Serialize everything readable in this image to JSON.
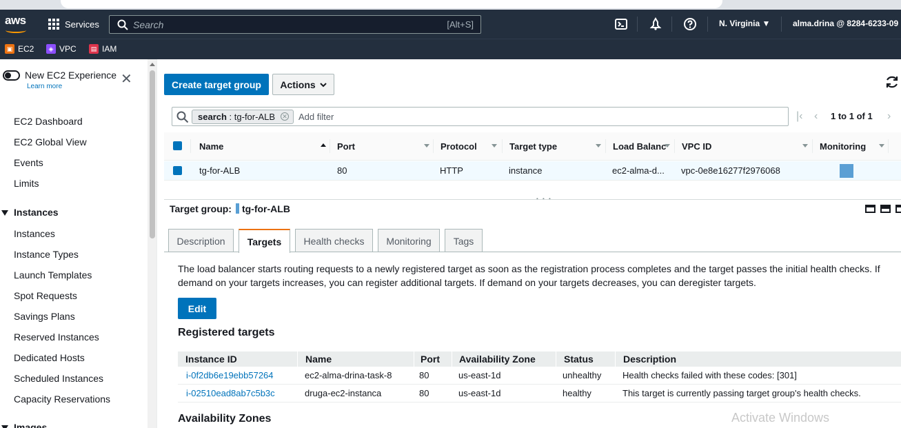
{
  "topnav": {
    "logo": "aws",
    "services_label": "Services",
    "search_placeholder": "Search",
    "search_shortcut": "[Alt+S]",
    "region": "N. Virginia",
    "account": "alma.drina @ 8284-6233-09"
  },
  "favorites": [
    {
      "label": "EC2",
      "color": "#ec7211"
    },
    {
      "label": "VPC",
      "color": "#8c4fff"
    },
    {
      "label": "IAM",
      "color": "#dd344c"
    }
  ],
  "sidebar": {
    "new_experience": "New EC2 Experience",
    "learn_more": "Learn more",
    "top_items": [
      "EC2 Dashboard",
      "EC2 Global View",
      "Events",
      "Limits"
    ],
    "instances_section": "Instances",
    "instance_items": [
      "Instances",
      "Instance Types",
      "Launch Templates",
      "Spot Requests",
      "Savings Plans",
      "Reserved Instances",
      "Dedicated Hosts",
      "Scheduled Instances",
      "Capacity Reservations"
    ],
    "images_section": "Images"
  },
  "toolbar": {
    "create_label": "Create target group",
    "actions_label": "Actions"
  },
  "filter": {
    "token_key": "search",
    "token_value": ": tg-for-ALB",
    "add_filter": "Add filter"
  },
  "pager": {
    "count": "1 to 1 of 1"
  },
  "table": {
    "columns": [
      "Name",
      "Port",
      "Protocol",
      "Target type",
      "Load Balanc",
      "VPC ID",
      "Monitoring"
    ],
    "row": {
      "name": "tg-for-ALB",
      "port": "80",
      "protocol": "HTTP",
      "target_type": "instance",
      "load_balancer": "ec2-alma-d...",
      "vpc_id": "vpc-0e8e16277f2976068"
    }
  },
  "detail": {
    "title_label": "Target group:",
    "title_value": "tg-for-ALB",
    "tabs": [
      "Description",
      "Targets",
      "Health checks",
      "Monitoring",
      "Tags"
    ],
    "active_tab": "Targets",
    "info": "The load balancer starts routing requests to a newly registered target as soon as the registration process completes and the target passes the initial health checks. If demand on your targets increases, you can register additional targets. If demand on your targets decreases, you can deregister targets.",
    "edit_label": "Edit",
    "registered_heading": "Registered targets",
    "az_heading": "Availability Zones"
  },
  "registered_targets": {
    "columns": [
      "Instance ID",
      "Name",
      "Port",
      "Availability Zone",
      "Status",
      "Description"
    ],
    "rows": [
      {
        "instance_id": "i-0f2db6e19ebb57264",
        "name": "ec2-alma-drina-task-8",
        "port": "80",
        "az": "us-east-1d",
        "status": "unhealthy",
        "description": "Health checks failed with these codes: [301]"
      },
      {
        "instance_id": "i-02510ead8ab7c5b3c",
        "name": "druga-ec2-instanca",
        "port": "80",
        "az": "us-east-1d",
        "status": "healthy",
        "description": "This target is currently passing target group's health checks."
      }
    ]
  },
  "watermark": "Activate Windows"
}
